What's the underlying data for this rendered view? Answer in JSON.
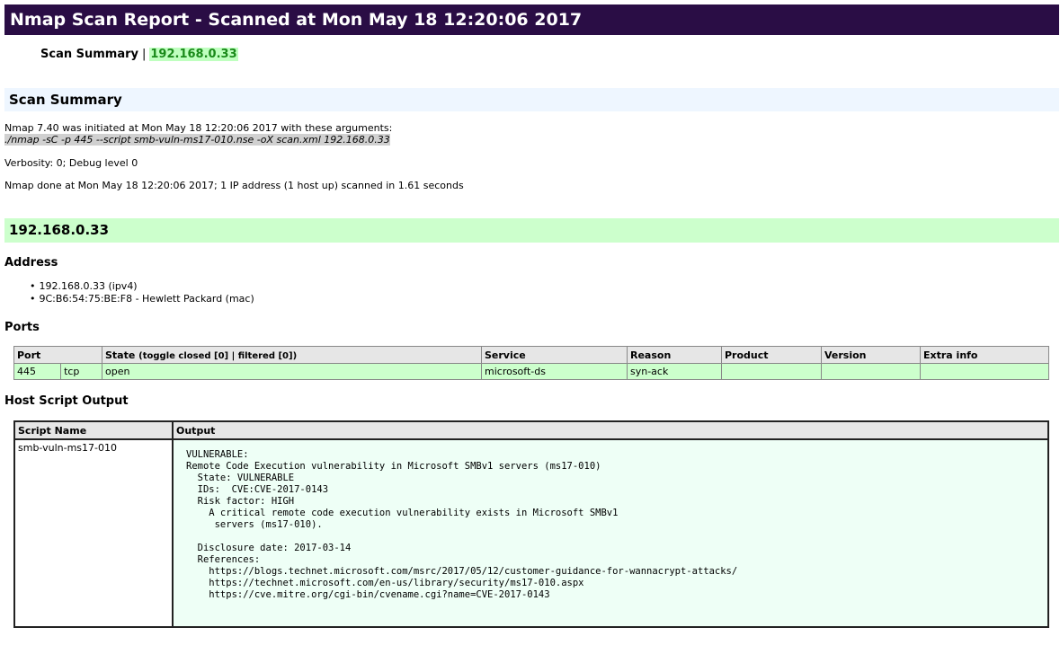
{
  "title": "Nmap Scan Report - Scanned at Mon May 18 12:20:06 2017",
  "nav": {
    "summary_label": "Scan Summary",
    "separator": "|",
    "host_link": "192.168.0.33"
  },
  "summary": {
    "heading": "Scan Summary",
    "initiated": "Nmap 7.40 was initiated at Mon May 18 12:20:06 2017 with these arguments:",
    "arguments": "./nmap -sC -p 445 --script smb-vuln-ms17-010.nse -oX scan.xml 192.168.0.33",
    "verbosity": "Verbosity: 0; Debug level 0",
    "done": "Nmap done at Mon May 18 12:20:06 2017; 1 IP address (1 host up) scanned in 1.61 seconds"
  },
  "host": {
    "heading": "192.168.0.33",
    "address_heading": "Address",
    "addresses": [
      "192.168.0.33 (ipv4)",
      "9C:B6:54:75:BE:F8 - Hewlett Packard (mac)"
    ],
    "ports_heading": "Ports",
    "ports_table": {
      "headers": {
        "port": "Port",
        "state": "State",
        "toggle_prefix": "(toggle closed [0] |",
        "toggle_filtered": "filtered [0])",
        "service": "Service",
        "reason": "Reason",
        "product": "Product",
        "version": "Version",
        "extra": "Extra info"
      },
      "rows": [
        {
          "port": "445",
          "proto": "tcp",
          "state": "open",
          "service": "microsoft-ds",
          "reason": "syn-ack",
          "product": "",
          "version": "",
          "extra": ""
        }
      ]
    },
    "script_heading": "Host Script Output",
    "script_table": {
      "headers": {
        "name": "Script Name",
        "output": "Output"
      },
      "rows": [
        {
          "name": "smb-vuln-ms17-010",
          "output": "VULNERABLE:\nRemote Code Execution vulnerability in Microsoft SMBv1 servers (ms17-010)\n  State: VULNERABLE\n  IDs:  CVE:CVE-2017-0143\n  Risk factor: HIGH\n    A critical remote code execution vulnerability exists in Microsoft SMBv1\n     servers (ms17-010).\n\n  Disclosure date: 2017-03-14\n  References:\n    https://blogs.technet.microsoft.com/msrc/2017/05/12/customer-guidance-for-wannacrypt-attacks/\n    https://technet.microsoft.com/en-us/library/security/ms17-010.aspx\n    https://cve.mitre.org/cgi-bin/cvename.cgi?name=CVE-2017-0143"
        }
      ]
    }
  }
}
